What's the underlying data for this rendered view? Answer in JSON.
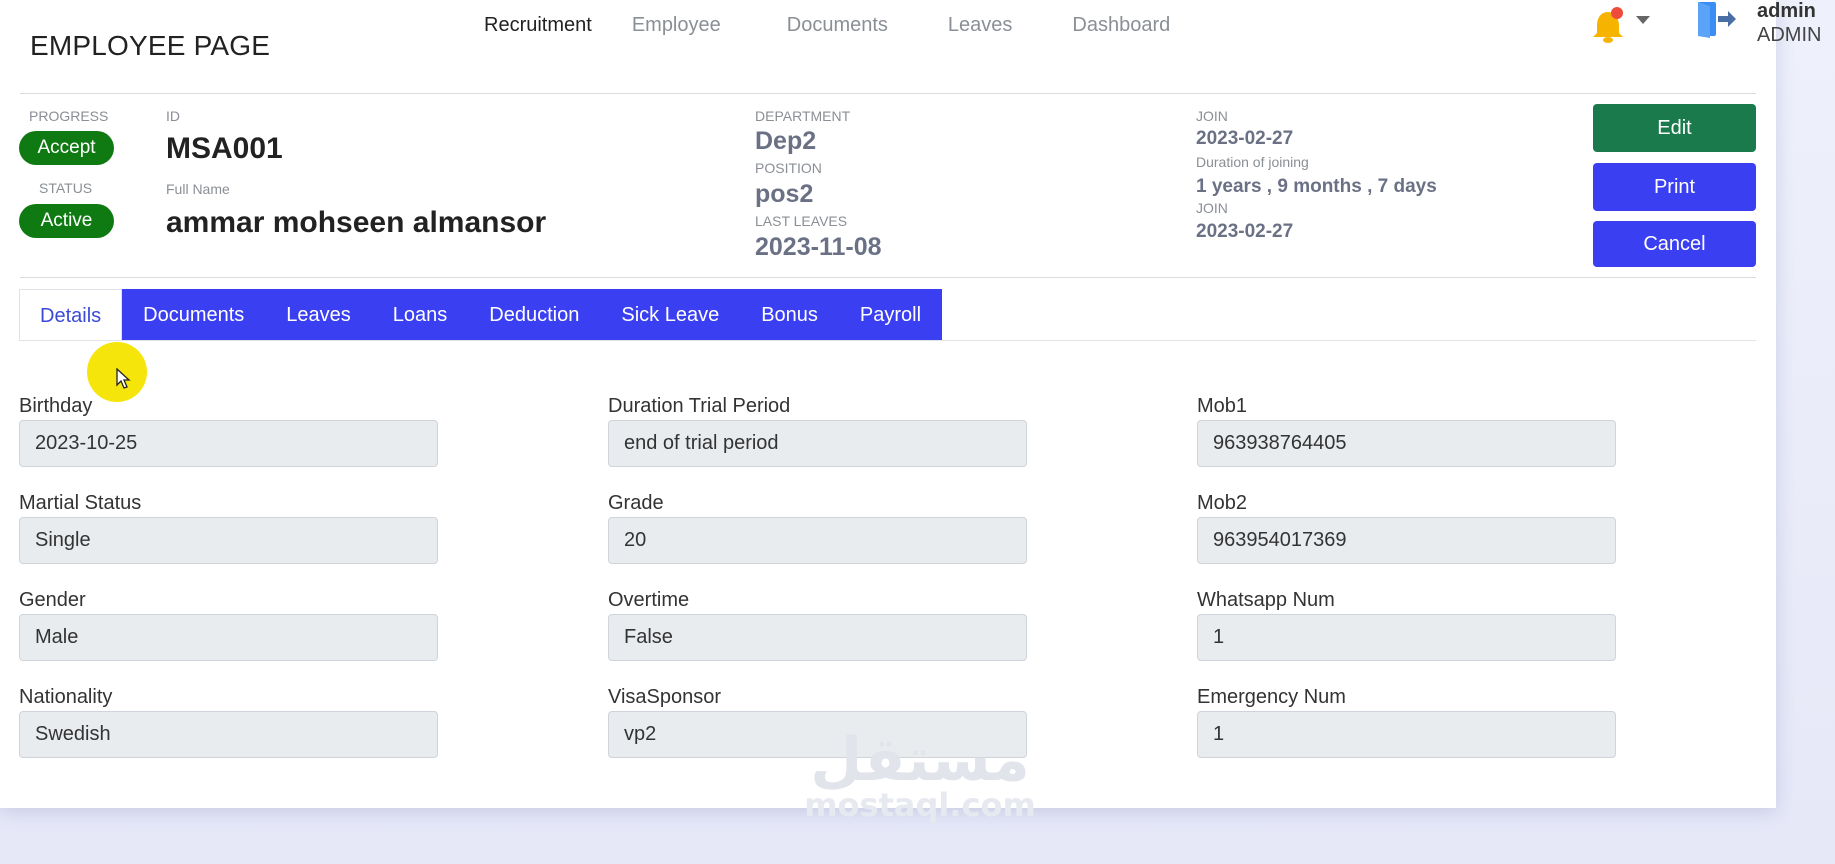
{
  "header": {
    "title": "EMPLOYEE PAGE",
    "nav": [
      "Recruitment",
      "Employee",
      "Documents",
      "Leaves",
      "Dashboard"
    ],
    "active_nav": "Recruitment",
    "user": {
      "name": "admin",
      "role": "ADMIN"
    }
  },
  "summary": {
    "progress_label": "PROGRESS",
    "progress_value": "Accept",
    "status_label": "STATUS",
    "status_value": "Active",
    "id_label": "ID",
    "id_value": "MSA001",
    "fullname_label": "Full Name",
    "fullname_value": "ammar mohseen almansor",
    "department_label": "DEPARTMENT",
    "department_value": "Dep2",
    "position_label": "POSITION",
    "position_value": "pos2",
    "last_leaves_label": "LAST LEAVES",
    "last_leaves_value": "2023-11-08",
    "join_label": "JOIN",
    "join_value": "2023-02-27",
    "duration_label": "Duration of joining",
    "duration_value": "1 years , 9 months , 7 days",
    "join2_label": "JOIN",
    "join2_value": "2023-02-27"
  },
  "actions": {
    "edit": "Edit",
    "print": "Print",
    "cancel": "Cancel"
  },
  "tabs": [
    "Details",
    "Documents",
    "Leaves",
    "Loans",
    "Deduction",
    "Sick Leave",
    "Bonus",
    "Payroll"
  ],
  "active_tab": "Details",
  "details": {
    "col1": [
      {
        "label": "Birthday",
        "value": "2023-10-25"
      },
      {
        "label": "Martial Status",
        "value": "Single"
      },
      {
        "label": "Gender",
        "value": "Male"
      },
      {
        "label": "Nationality",
        "value": "Swedish"
      }
    ],
    "col2": [
      {
        "label": "Duration Trial Period",
        "value": "end of trial period"
      },
      {
        "label": "Grade",
        "value": "20"
      },
      {
        "label": "Overtime",
        "value": "False"
      },
      {
        "label": "VisaSponsor",
        "value": "vp2"
      }
    ],
    "col3": [
      {
        "label": "Mob1",
        "value": "963938764405"
      },
      {
        "label": "Mob2",
        "value": "963954017369"
      },
      {
        "label": "Whatsapp Num",
        "value": "1"
      },
      {
        "label": "Emergency Num",
        "value": "1"
      }
    ]
  },
  "watermark": {
    "arabic": "مستقل",
    "latin": "mostaql.com"
  },
  "colors": {
    "primary": "#3b3ff2",
    "success": "#1a7a4c",
    "pill": "#0f7a12",
    "muted_value": "#6b7185"
  },
  "icons": [
    "bell-icon",
    "chevron-down-icon",
    "logout-icon",
    "cursor-icon"
  ]
}
